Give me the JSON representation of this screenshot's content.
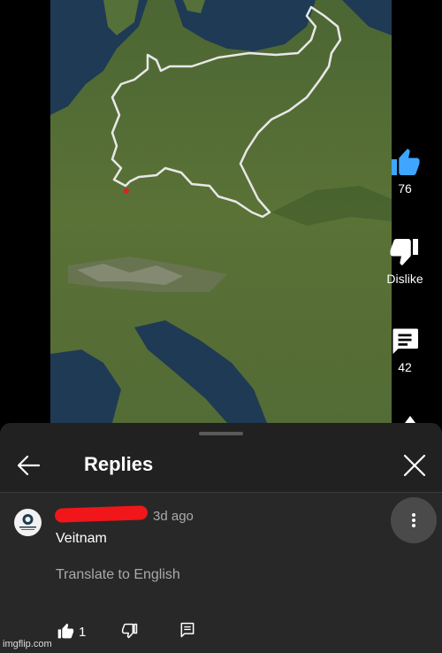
{
  "video": {
    "actions": {
      "like_count": "76",
      "dislike_label": "Dislike",
      "comment_count": "42"
    }
  },
  "replies": {
    "title": "Replies",
    "comment": {
      "timestamp": "3d ago",
      "text": "Veitnam",
      "translate_label": "Translate to English",
      "like_count": "1"
    }
  },
  "watermark": "imgflip.com",
  "colors": {
    "sheet_bg": "#212121",
    "comment_bg": "#282828",
    "like_accent": "#3ea6ff",
    "redaction": "#f0161a"
  }
}
